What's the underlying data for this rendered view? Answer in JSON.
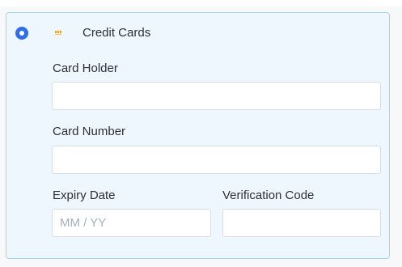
{
  "payment_method": {
    "label": "Credit Cards",
    "selected": true,
    "icon": "credit-card-icon"
  },
  "form": {
    "card_holder": {
      "label": "Card Holder",
      "value": "",
      "placeholder": ""
    },
    "card_number": {
      "label": "Card Number",
      "value": "",
      "placeholder": ""
    },
    "expiry_date": {
      "label": "Expiry Date",
      "value": "",
      "placeholder": "MM / YY"
    },
    "verification_code": {
      "label": "Verification Code",
      "value": "",
      "placeholder": ""
    }
  },
  "colors": {
    "accent": "#2f6ee8",
    "panel_background": "#eef7fd",
    "panel_border": "#9fd7ec",
    "icon_orange": "#f39a2b"
  }
}
